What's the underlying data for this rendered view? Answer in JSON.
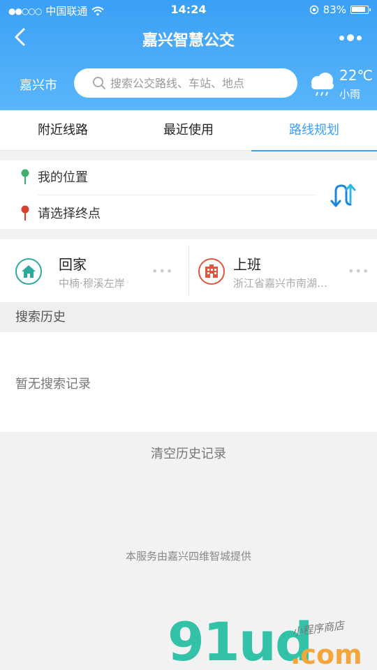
{
  "status": {
    "carrier": "中国联通",
    "time": "14:24",
    "battery": "83%"
  },
  "nav": {
    "title": "嘉兴智慧公交"
  },
  "search": {
    "city": "嘉兴市",
    "placeholder": "搜索公交路线、车站、地点"
  },
  "weather": {
    "temp": "22℃",
    "condition": "小雨"
  },
  "tabs": [
    {
      "label": "附近线路",
      "active": false
    },
    {
      "label": "最近使用",
      "active": false
    },
    {
      "label": "路线规划",
      "active": true
    }
  ],
  "route": {
    "origin": "我的位置",
    "destination": "请选择终点"
  },
  "favorites": [
    {
      "name": "回家",
      "address": "中楠·穆溪左岸",
      "icon": "home-icon",
      "color": "#2cab9c"
    },
    {
      "name": "上班",
      "address": "浙江省嘉兴市南湖…",
      "icon": "office-building-icon",
      "color": "#e0553d"
    }
  ],
  "history": {
    "header": "搜索历史",
    "empty_text": "暂无搜索记录",
    "clear_label": "清空历史记录"
  },
  "footer": {
    "text": "本服务由嘉兴四维智城提供"
  },
  "watermark": {
    "main": "91ud",
    "suffix": ".com",
    "sub": "小程序商店"
  },
  "colors": {
    "primary": "#3aa0f5",
    "pin_origin": "#3db06a",
    "pin_dest": "#d8402c"
  }
}
